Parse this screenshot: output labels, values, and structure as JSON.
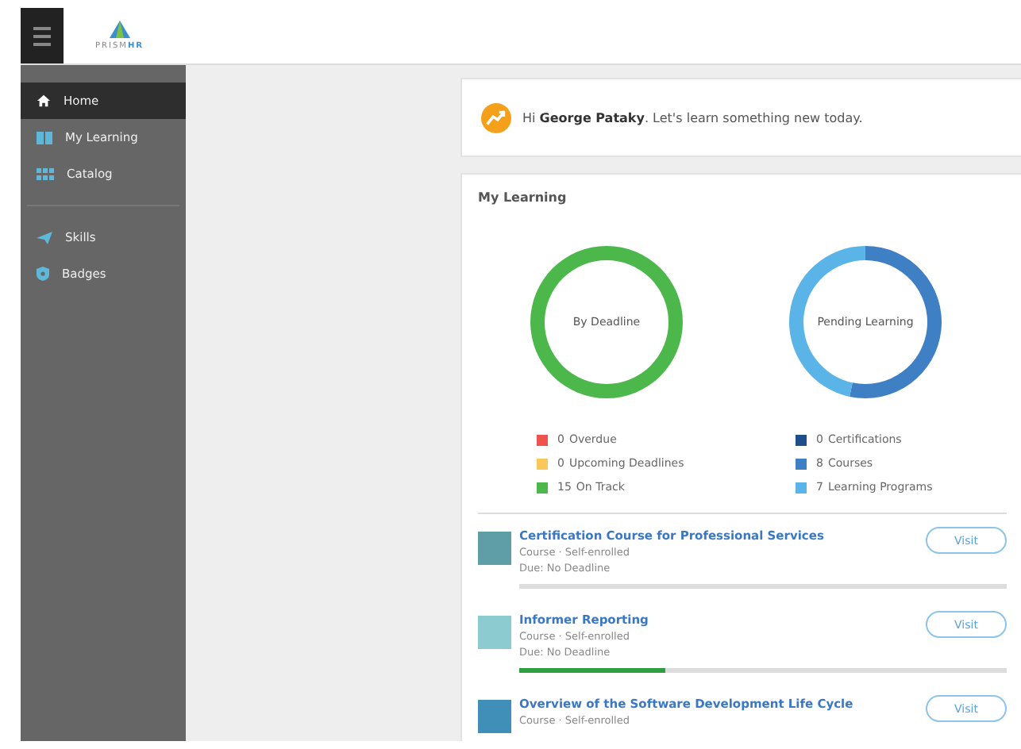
{
  "brand": {
    "name": "PRISM",
    "name_accent": "HR"
  },
  "sidebar": {
    "groups": [
      [
        {
          "label": "Home",
          "selected": true
        },
        {
          "label": "My Learning",
          "selected": false
        },
        {
          "label": "Catalog",
          "selected": false
        }
      ],
      [
        {
          "label": "Skills",
          "selected": false
        },
        {
          "label": "Badges",
          "selected": false
        }
      ]
    ]
  },
  "greeting": {
    "text": "Hi **George Pataky**. Let's learn something new today."
  },
  "my_learning": {
    "title": "My Learning",
    "charts": [
      {
        "title": "By Deadline",
        "legend": [
          {
            "count": "0",
            "label": "Overdue",
            "color": "#ef5350"
          },
          {
            "count": "0",
            "label": "Upcoming Deadlines",
            "color": "#f9c85b"
          },
          {
            "count": "15",
            "label": "On Track",
            "color": "#4cb84c"
          }
        ]
      },
      {
        "title": "Pending Learning",
        "legend": [
          {
            "count": "0",
            "label": "Certifications",
            "color": "#1f4f8a"
          },
          {
            "count": "8",
            "label": "Courses",
            "color": "#3f7fc4"
          },
          {
            "count": "7",
            "label": "Learning Programs",
            "color": "#5ab4e8"
          }
        ]
      }
    ],
    "courses": [
      {
        "title": "Certification Course for Professional Services",
        "meta": "Course · Self-enrolled",
        "due": "Due: No Deadline",
        "color": "#5f9ea7",
        "button": "Visit"
      },
      {
        "title": "Informer Reporting",
        "meta": "Course · Self-enrolled",
        "due": "Due: No Deadline",
        "level": 0.3,
        "color": "#8ccbd0",
        "button": "Visit"
      },
      {
        "title": "Overview of the Software Development Life Cycle",
        "meta": "Course · Self-enrolled",
        "color": "#3f8fb8",
        "button": "Visit"
      }
    ]
  }
}
